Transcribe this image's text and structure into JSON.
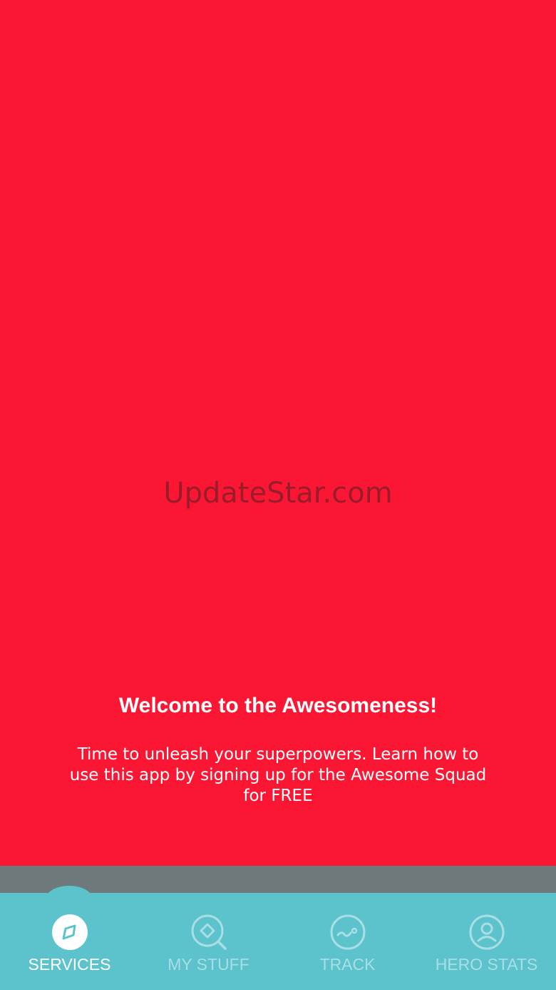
{
  "watermark": "UpdateStar.com",
  "welcome": {
    "title": "Welcome to the Awesomeness!",
    "body": "Time to unleash your superpowers. Learn how to use this app by signing up for the Awesome Squad for FREE"
  },
  "tabs": [
    {
      "label": "SERVICES",
      "icon": "compass-icon",
      "active": true
    },
    {
      "label": "MY STUFF",
      "icon": "search-icon",
      "active": false
    },
    {
      "label": "TRACK",
      "icon": "track-icon",
      "active": false
    },
    {
      "label": "HERO STATS",
      "icon": "profile-icon",
      "active": false
    }
  ],
  "colors": {
    "background": "#fb1733",
    "tabbar": "#5cc3cd",
    "active_label": "#ffffff",
    "inactive_label": "#a9dfe4"
  }
}
